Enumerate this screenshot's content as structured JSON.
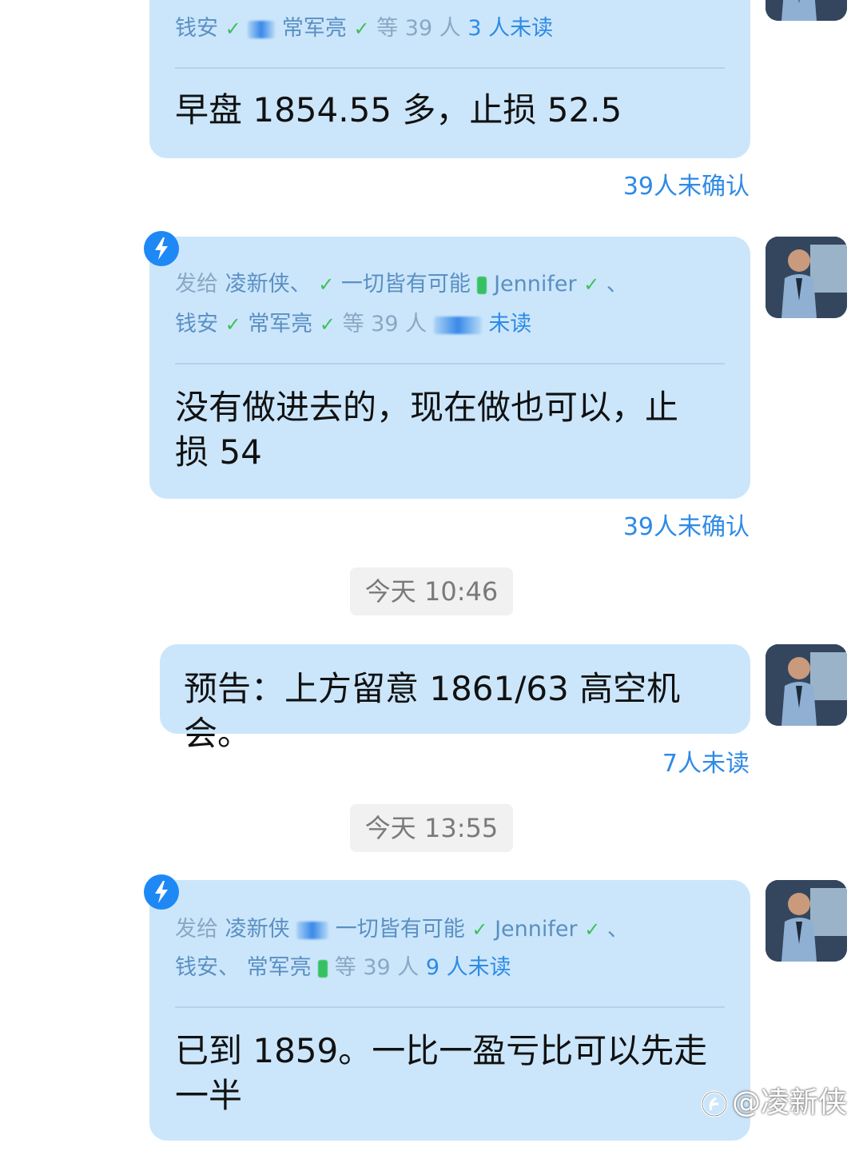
{
  "messages": [
    {
      "recipients_line2_prefix": "钱安",
      "recipients_line2_name": "常军亮",
      "recipients_count": "等 39 人",
      "recipients_unread": "3 人未读",
      "text": "早盘 1854.55 多，止损 52.5",
      "status": "39人未确认"
    },
    {
      "recipients_label": "发给",
      "recipients_name1": "凌新侠、",
      "recipients_name2": "一切皆有可能",
      "recipients_name3": "Jennifer",
      "recipients_sep": "、",
      "recipients_line2_prefix": "钱安",
      "recipients_line2_name": "常军亮",
      "recipients_count": "等 39 人",
      "recipients_unread": "未读",
      "text": "没有做进去的，现在做也可以，止损 54",
      "status": "39人未确认"
    },
    {
      "text": "预告：上方留意 1861/63 高空机会。",
      "status": "7人未读"
    },
    {
      "recipients_label": "发给",
      "recipients_name1": "凌新侠",
      "recipients_name2": "一切皆有可能",
      "recipients_name3": "Jennifer",
      "recipients_sep": "、",
      "recipients_line2_prefix": "钱安、",
      "recipients_line2_name": "常军亮",
      "recipients_count": "等 39 人",
      "recipients_unread": "9 人未读",
      "text": "已到 1859。一比一盈亏比可以先走一半"
    }
  ],
  "timestamps": [
    "今天 10:46",
    "今天 13:55"
  ],
  "watermark": "@凌新侠",
  "icons": {
    "ding": "lightning-icon",
    "check": "check-circle-icon",
    "avatar": "user-avatar"
  },
  "colors": {
    "bubble": "#cbe6fb",
    "accent": "#2e8ae6",
    "check": "#3fbf5a",
    "ding": "#1e88f5"
  }
}
